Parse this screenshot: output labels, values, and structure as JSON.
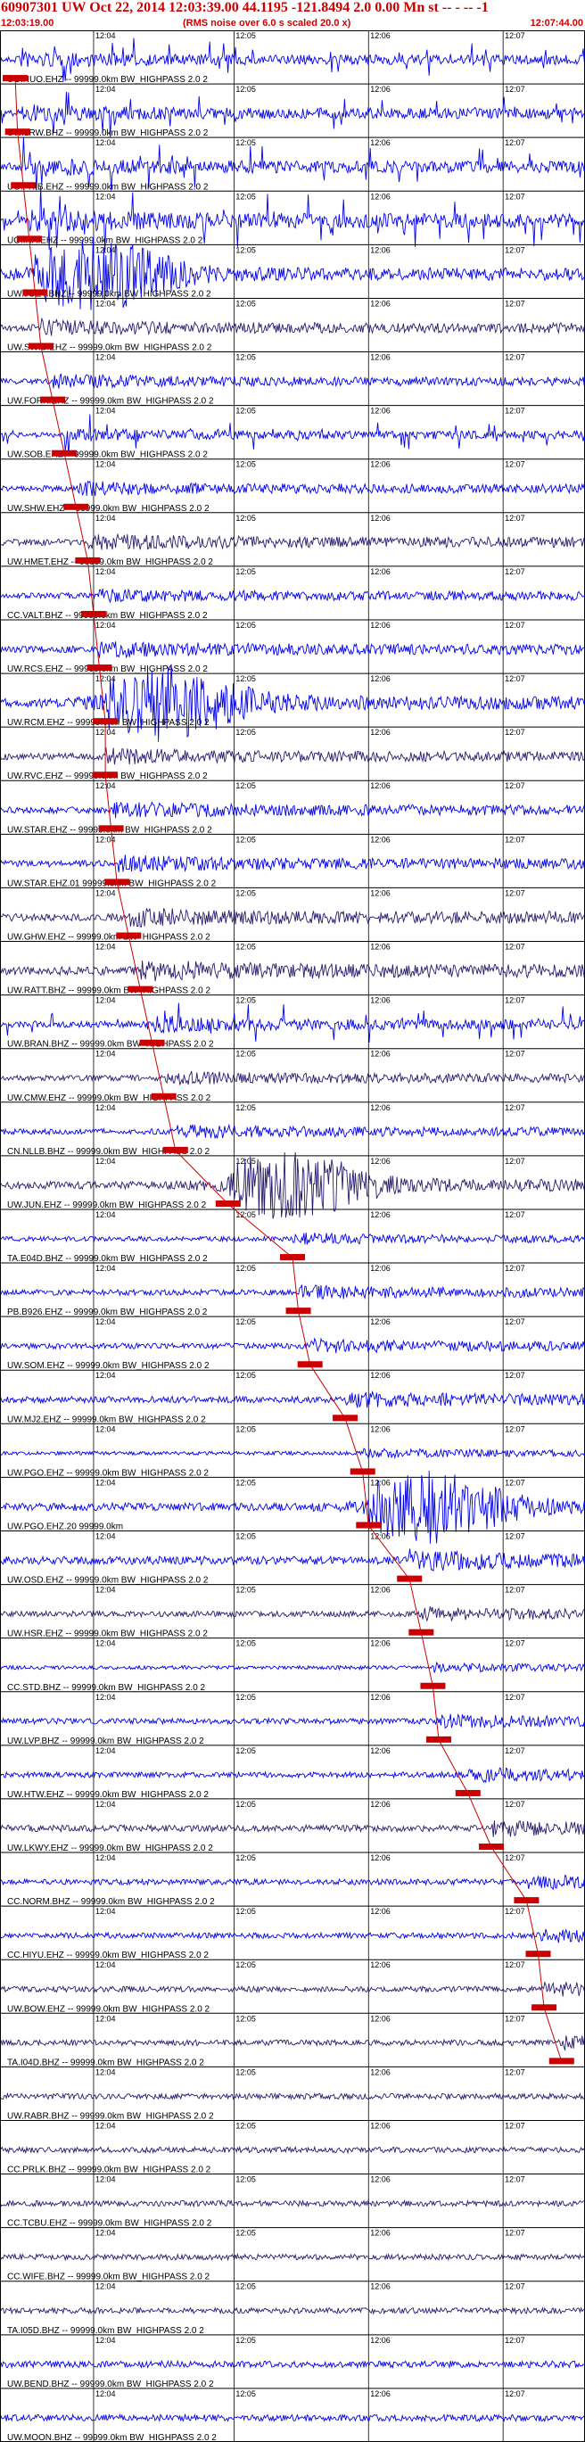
{
  "header": {
    "title": "60907301 UW Oct 22, 2014 12:03:39.00   44.1195  -121.8494  2.0  0.00 Mn st -- - --  -1",
    "start_time": "12:03:19.00",
    "rms_note": "(RMS noise over 6.0 s scaled 20.0 x)",
    "end_time": "12:07:44.00"
  },
  "time_ticks": [
    "12:04",
    "12:05",
    "12:06",
    "12:07"
  ],
  "colors": {
    "dark_trace": "#2a1a6e",
    "blue_trace": "#0000ee",
    "pick": "#cc0000",
    "axis": "#000000"
  },
  "traces": [
    {
      "label": "UO.HUO.EHZ -- 99999.0km BW_HIGHPASS  2.0  2",
      "color": "blue",
      "amp": 0.55,
      "pick": 0.026,
      "bursty": 1
    },
    {
      "label": "UW.LRW.BHZ -- 99999.0km BW_HIGHPASS  2.0  2",
      "color": "blue",
      "amp": 0.6,
      "pick": 0.03,
      "bursty": 1
    },
    {
      "label": "UO.FRIB.EHZ -- 99999.0km BW_HIGHPASS  2.0  2",
      "color": "blue",
      "amp": 0.65,
      "pick": 0.04,
      "bursty": 1
    },
    {
      "label": "UO.IRA.EHZ -- 99999.0km BW_HIGHPASS  2.0  2",
      "color": "blue",
      "amp": 0.8,
      "pick": 0.05,
      "bursty": 1
    },
    {
      "label": "UW.JOEY.BHZ -- 99999.0km BW_HIGHPASS  2.0  2",
      "color": "blue",
      "amp": 0.85,
      "pick": 0.06,
      "bursty": 2
    },
    {
      "label": "UW.SWIS.EHZ -- 99999.0km BW_HIGHPASS  2.0  2",
      "color": "dark",
      "amp": 0.35,
      "pick": 0.07,
      "bursty": 0
    },
    {
      "label": "UW.FORK.EHZ -- 99999.0km BW_HIGHPASS  2.0  2",
      "color": "blue",
      "amp": 0.3,
      "pick": 0.09,
      "bursty": 0
    },
    {
      "label": "UW.SOB.EHZ -- 99999.0km BW_HIGHPASS  2.0  2",
      "color": "blue",
      "amp": 0.45,
      "pick": 0.11,
      "bursty": 1
    },
    {
      "label": "UW.SHW.EHZ -- 99999.0km BW_HIGHPASS  2.0  2",
      "color": "blue",
      "amp": 0.3,
      "pick": 0.13,
      "bursty": 0
    },
    {
      "label": "UW.HMET.EHZ -- 99999.0km BW_HIGHPASS  2.0  2",
      "color": "dark",
      "amp": 0.35,
      "pick": 0.15,
      "bursty": 0
    },
    {
      "label": "CC.VALT.BHZ -- 99999.0km BW_HIGHPASS  2.0  2",
      "color": "blue",
      "amp": 0.3,
      "pick": 0.16,
      "bursty": 0
    },
    {
      "label": "UW.RCS.EHZ -- 99999.0km BW_HIGHPASS  2.0  2",
      "color": "blue",
      "amp": 0.35,
      "pick": 0.17,
      "bursty": 0
    },
    {
      "label": "UW.RCM.EHZ -- 99999.0km BW_HIGHPASS  2.0  2",
      "color": "blue",
      "amp": 0.9,
      "pick": 0.18,
      "bursty": 2
    },
    {
      "label": "UW.RVC.EHZ -- 99999.0km BW_HIGHPASS  2.0  2",
      "color": "dark",
      "amp": 0.35,
      "pick": 0.18,
      "bursty": 0
    },
    {
      "label": "UW.STAR.EHZ -- 99999.0km BW_HIGHPASS  2.0  2",
      "color": "blue",
      "amp": 0.35,
      "pick": 0.19,
      "bursty": 0
    },
    {
      "label": "UW.STAR.EHZ.01  99999.0km BW_HIGHPASS  2.0  2",
      "color": "blue",
      "amp": 0.35,
      "pick": 0.2,
      "bursty": 0
    },
    {
      "label": "UW.GHW.EHZ -- 99999.0km BW_HIGHPASS  2.0  2",
      "color": "dark",
      "amp": 0.4,
      "pick": 0.22,
      "bursty": 0
    },
    {
      "label": "UW.RATT.BHZ -- 99999.0km BW_HIGHPASS  2.0  2",
      "color": "dark",
      "amp": 0.45,
      "pick": 0.24,
      "bursty": 0
    },
    {
      "label": "UW.BRAN.BHZ -- 99999.0km BW_HIGHPASS  2.0  2",
      "color": "blue",
      "amp": 0.55,
      "pick": 0.26,
      "bursty": 1
    },
    {
      "label": "UW.CMW.EHZ -- 99999.0km BW_HIGHPASS  2.0  2",
      "color": "dark",
      "amp": 0.3,
      "pick": 0.28,
      "bursty": 0
    },
    {
      "label": "CN.NLLB.BHZ -- 99999.0km BW_HIGHPASS  2.0  2",
      "color": "blue",
      "amp": 0.3,
      "pick": 0.3,
      "bursty": 0
    },
    {
      "label": "UW.JUN.EHZ -- 99999.0km BW_HIGHPASS  2.0  2",
      "color": "dark",
      "amp": 0.8,
      "pick": 0.39,
      "bursty": 2
    },
    {
      "label": "TA.E04D.BHZ -- 99999.0km BW_HIGHPASS  2.0  2",
      "color": "blue",
      "amp": 0.25,
      "pick": 0.5,
      "bursty": 0
    },
    {
      "label": "PB.B926.EHZ -- 99999.0km BW_HIGHPASS  2.0  2",
      "color": "blue",
      "amp": 0.3,
      "pick": 0.51,
      "bursty": 0
    },
    {
      "label": "UW.SOM.EHZ -- 99999.0km BW_HIGHPASS  2.0  2",
      "color": "blue",
      "amp": 0.3,
      "pick": 0.53,
      "bursty": 0
    },
    {
      "label": "UW.MJ2.EHZ -- 99999.0km BW_HIGHPASS  2.0  2",
      "color": "blue",
      "amp": 0.35,
      "pick": 0.59,
      "bursty": 0
    },
    {
      "label": "UW.PGO.EHZ -- 99999.0km BW_HIGHPASS  2.0  2",
      "color": "blue",
      "amp": 0.2,
      "pick": 0.62,
      "bursty": 0
    },
    {
      "label": "UW.PGO.EHZ.20  99999.0km",
      "color": "blue",
      "amp": 0.85,
      "pick": 0.63,
      "bursty": 2
    },
    {
      "label": "UW.OSD.EHZ -- 99999.0km BW_HIGHPASS  2.0  2",
      "color": "blue",
      "amp": 0.45,
      "pick": 0.7,
      "bursty": 0
    },
    {
      "label": "UW.HSR.EHZ -- 99999.0km BW_HIGHPASS  2.0  2",
      "color": "dark",
      "amp": 0.3,
      "pick": 0.72,
      "bursty": 0
    },
    {
      "label": "CC.STD.BHZ -- 99999.0km BW_HIGHPASS  2.0  2",
      "color": "blue",
      "amp": 0.2,
      "pick": 0.74,
      "bursty": 0
    },
    {
      "label": "UW.LVP.BHZ -- 99999.0km BW_HIGHPASS  2.0  2",
      "color": "blue",
      "amp": 0.3,
      "pick": 0.75,
      "bursty": 0
    },
    {
      "label": "UW.HTW.EHZ -- 99999.0km BW_HIGHPASS  2.0  2",
      "color": "blue",
      "amp": 0.3,
      "pick": 0.8,
      "bursty": 0
    },
    {
      "label": "UW.LKWY.EHZ -- 99999.0km BW_HIGHPASS  2.0  2",
      "color": "dark",
      "amp": 0.35,
      "pick": 0.84,
      "bursty": 0
    },
    {
      "label": "CC.NORM.BHZ -- 99999.0km BW_HIGHPASS  2.0  2",
      "color": "blue",
      "amp": 0.3,
      "pick": 0.9,
      "bursty": 0
    },
    {
      "label": "CC.HIYU.EHZ -- 99999.0km BW_HIGHPASS  2.0  2",
      "color": "blue",
      "amp": 0.3,
      "pick": 0.92,
      "bursty": 0
    },
    {
      "label": "UW.BOW.EHZ -- 99999.0km BW_HIGHPASS  2.0  2",
      "color": "dark",
      "amp": 0.3,
      "pick": 0.93,
      "bursty": 0
    },
    {
      "label": "TA.I04D.BHZ -- 99999.0km BW_HIGHPASS  2.0  2",
      "color": "dark",
      "amp": 0.3,
      "pick": 0.96,
      "bursty": 0
    },
    {
      "label": "UW.RABR.BHZ -- 99999.0km BW_HIGHPASS  2.0  2",
      "color": "dark",
      "amp": 0.3,
      "pick": null,
      "bursty": 0
    },
    {
      "label": "CC.PRLK.BHZ -- 99999.0km BW_HIGHPASS  2.0  2",
      "color": "dark",
      "amp": 0.3,
      "pick": null,
      "bursty": 0
    },
    {
      "label": "CC.TCBU.EHZ -- 99999.0km BW_HIGHPASS  2.0  2",
      "color": "dark",
      "amp": 0.3,
      "pick": null,
      "bursty": 0
    },
    {
      "label": "CC.WIFE.BHZ -- 99999.0km BW_HIGHPASS  2.0  2",
      "color": "dark",
      "amp": 0.3,
      "pick": null,
      "bursty": 0
    },
    {
      "label": "TA.I05D.BHZ -- 99999.0km BW_HIGHPASS  2.0  2",
      "color": "dark",
      "amp": 0.3,
      "pick": null,
      "bursty": 0
    },
    {
      "label": "UW.BEND.BHZ -- 99999.0km BW_HIGHPASS  2.0  2",
      "color": "blue",
      "amp": 0.35,
      "pick": null,
      "bursty": 0
    },
    {
      "label": "UW.MOON.BHZ -- 99999.0km BW_HIGHPASS  2.0  2",
      "color": "blue",
      "amp": 0.35,
      "pick": null,
      "bursty": 0
    }
  ]
}
